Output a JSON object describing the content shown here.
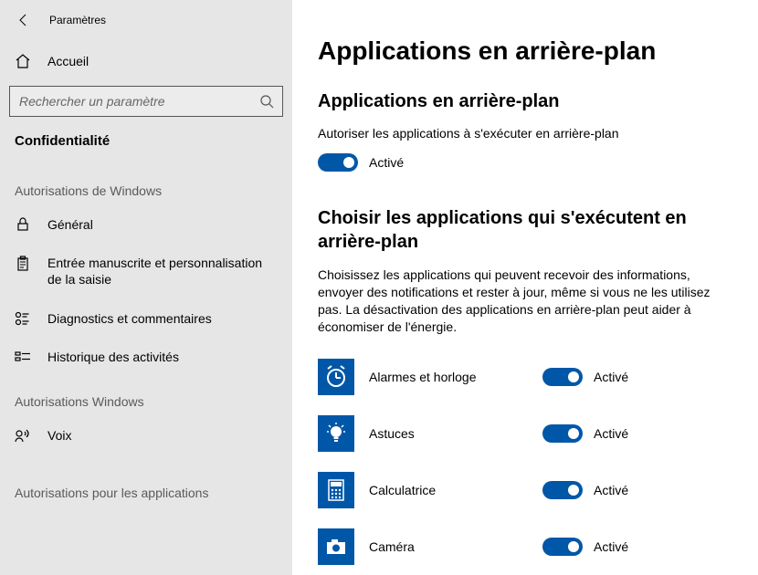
{
  "titlebar": {
    "title": "Paramètres"
  },
  "sidebar": {
    "home_label": "Accueil",
    "search_placeholder": "Rechercher un paramètre",
    "category": "Confidentialité",
    "section1_header": "Autorisations de Windows",
    "section1_items": [
      {
        "label": "Général"
      },
      {
        "label": "Entrée manuscrite et personnalisation de la saisie"
      },
      {
        "label": "Diagnostics et commentaires"
      },
      {
        "label": "Historique des activités"
      }
    ],
    "section2_header": "Autorisations Windows",
    "section2_items": [
      {
        "label": "Voix"
      }
    ],
    "section3_header": "Autorisations pour les applications"
  },
  "main": {
    "page_title": "Applications en arrière-plan",
    "section1": {
      "title": "Applications en arrière-plan",
      "desc": "Autoriser les applications à s'exécuter en arrière-plan",
      "toggle_state": "Activé"
    },
    "section2": {
      "title": "Choisir les applications qui s'exécutent en arrière-plan",
      "desc": "Choisissez les applications qui peuvent recevoir des informations, envoyer des notifications et rester à jour, même si vous ne les utilisez pas. La désactivation des applications en arrière-plan peut aider à économiser de l'énergie."
    },
    "apps": [
      {
        "name": "Alarmes et horloge",
        "state": "Activé"
      },
      {
        "name": "Astuces",
        "state": "Activé"
      },
      {
        "name": "Calculatrice",
        "state": "Activé"
      },
      {
        "name": "Caméra",
        "state": "Activé"
      }
    ]
  }
}
